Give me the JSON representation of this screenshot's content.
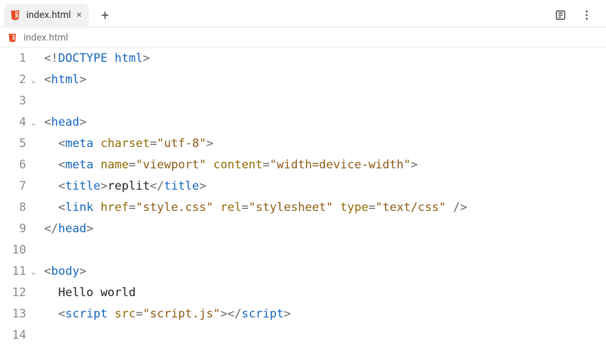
{
  "tab": {
    "filename": "index.html"
  },
  "breadcrumb": {
    "filename": "index.html"
  },
  "lines": [
    {
      "n": 1,
      "fold": false,
      "tokens": [
        {
          "c": "p",
          "t": "<!"
        },
        {
          "c": "dt",
          "t": "DOCTYPE html"
        },
        {
          "c": "p",
          "t": ">"
        }
      ]
    },
    {
      "n": 2,
      "fold": true,
      "tokens": [
        {
          "c": "p",
          "t": "<"
        },
        {
          "c": "tg",
          "t": "html"
        },
        {
          "c": "p",
          "t": ">"
        }
      ]
    },
    {
      "n": 3,
      "fold": false,
      "tokens": []
    },
    {
      "n": 4,
      "fold": true,
      "tokens": [
        {
          "c": "p",
          "t": "<"
        },
        {
          "c": "tg",
          "t": "head"
        },
        {
          "c": "p",
          "t": ">"
        }
      ]
    },
    {
      "n": 5,
      "fold": false,
      "tokens": [
        {
          "c": "tx",
          "t": "  "
        },
        {
          "c": "p",
          "t": "<"
        },
        {
          "c": "tg",
          "t": "meta"
        },
        {
          "c": "tx",
          "t": " "
        },
        {
          "c": "at",
          "t": "charset"
        },
        {
          "c": "p",
          "t": "="
        },
        {
          "c": "st",
          "t": "\"utf-8\""
        },
        {
          "c": "p",
          "t": ">"
        }
      ]
    },
    {
      "n": 6,
      "fold": false,
      "tokens": [
        {
          "c": "tx",
          "t": "  "
        },
        {
          "c": "p",
          "t": "<"
        },
        {
          "c": "tg",
          "t": "meta"
        },
        {
          "c": "tx",
          "t": " "
        },
        {
          "c": "at",
          "t": "name"
        },
        {
          "c": "p",
          "t": "="
        },
        {
          "c": "st",
          "t": "\"viewport\""
        },
        {
          "c": "tx",
          "t": " "
        },
        {
          "c": "at",
          "t": "content"
        },
        {
          "c": "p",
          "t": "="
        },
        {
          "c": "st",
          "t": "\"width=device-width\""
        },
        {
          "c": "p",
          "t": ">"
        }
      ]
    },
    {
      "n": 7,
      "fold": false,
      "tokens": [
        {
          "c": "tx",
          "t": "  "
        },
        {
          "c": "p",
          "t": "<"
        },
        {
          "c": "tg",
          "t": "title"
        },
        {
          "c": "p",
          "t": ">"
        },
        {
          "c": "tx",
          "t": "replit"
        },
        {
          "c": "p",
          "t": "</"
        },
        {
          "c": "tg",
          "t": "title"
        },
        {
          "c": "p",
          "t": ">"
        }
      ]
    },
    {
      "n": 8,
      "fold": false,
      "tokens": [
        {
          "c": "tx",
          "t": "  "
        },
        {
          "c": "p",
          "t": "<"
        },
        {
          "c": "tg",
          "t": "link"
        },
        {
          "c": "tx",
          "t": " "
        },
        {
          "c": "at",
          "t": "href"
        },
        {
          "c": "p",
          "t": "="
        },
        {
          "c": "st",
          "t": "\"style.css\""
        },
        {
          "c": "tx",
          "t": " "
        },
        {
          "c": "at",
          "t": "rel"
        },
        {
          "c": "p",
          "t": "="
        },
        {
          "c": "st",
          "t": "\"stylesheet\""
        },
        {
          "c": "tx",
          "t": " "
        },
        {
          "c": "at",
          "t": "type"
        },
        {
          "c": "p",
          "t": "="
        },
        {
          "c": "st",
          "t": "\"text/css\""
        },
        {
          "c": "tx",
          "t": " "
        },
        {
          "c": "p",
          "t": "/>"
        }
      ]
    },
    {
      "n": 9,
      "fold": false,
      "tokens": [
        {
          "c": "p",
          "t": "</"
        },
        {
          "c": "tg",
          "t": "head"
        },
        {
          "c": "p",
          "t": ">"
        }
      ]
    },
    {
      "n": 10,
      "fold": false,
      "tokens": []
    },
    {
      "n": 11,
      "fold": true,
      "tokens": [
        {
          "c": "p",
          "t": "<"
        },
        {
          "c": "tg",
          "t": "body"
        },
        {
          "c": "p",
          "t": ">"
        }
      ]
    },
    {
      "n": 12,
      "fold": false,
      "tokens": [
        {
          "c": "tx",
          "t": "  Hello world"
        }
      ]
    },
    {
      "n": 13,
      "fold": false,
      "tokens": [
        {
          "c": "tx",
          "t": "  "
        },
        {
          "c": "p",
          "t": "<"
        },
        {
          "c": "tg",
          "t": "script"
        },
        {
          "c": "tx",
          "t": " "
        },
        {
          "c": "at",
          "t": "src"
        },
        {
          "c": "p",
          "t": "="
        },
        {
          "c": "st",
          "t": "\"script.js\""
        },
        {
          "c": "p",
          "t": ">"
        },
        {
          "c": "p",
          "t": "</"
        },
        {
          "c": "tg",
          "t": "script"
        },
        {
          "c": "p",
          "t": ">"
        }
      ]
    },
    {
      "n": 14,
      "fold": false,
      "tokens": []
    }
  ]
}
